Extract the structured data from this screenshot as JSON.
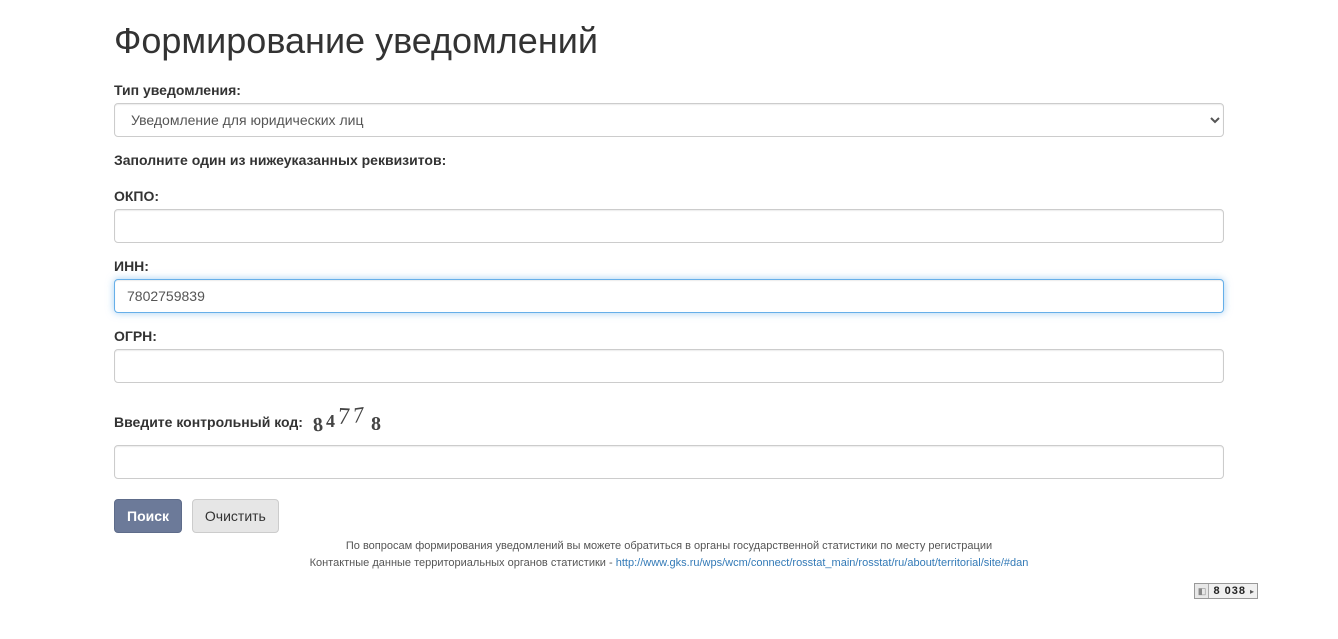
{
  "page": {
    "title": "Формирование уведомлений"
  },
  "form": {
    "type_label": "Тип уведомления:",
    "type_value": "Уведомление для юридических лиц",
    "instruction": "Заполните один из нижеуказанных реквизитов:",
    "okpo_label": "ОКПО:",
    "okpo_value": "",
    "inn_label": "ИНН:",
    "inn_value": "7802759839",
    "ogrn_label": "ОГРН:",
    "ogrn_value": "",
    "captcha_label": "Введите контрольный код:",
    "captcha_code": "84778",
    "captcha_value": ""
  },
  "buttons": {
    "search": "Поиск",
    "clear": "Очистить"
  },
  "footer": {
    "line1": "По вопросам формирования уведомлений вы можете обратиться в органы государственной статистики по месту регистрации",
    "line2_prefix": "Контактные данные территориальных органов статистики - ",
    "line2_link": "http://www.gks.ru/wps/wcm/connect/rosstat_main/rosstat/ru/about/territorial/site/#dan"
  },
  "counter": {
    "value": "8 038"
  }
}
